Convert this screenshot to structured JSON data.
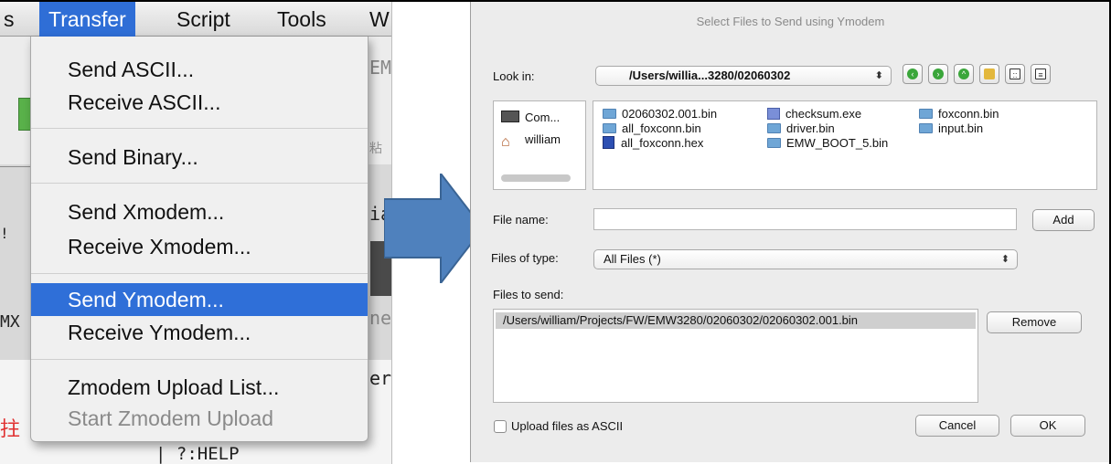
{
  "menubar": {
    "items": [
      {
        "label": "s"
      },
      {
        "label": "Transfer"
      },
      {
        "label": "Script"
      },
      {
        "label": "Tools"
      },
      {
        "label": "W"
      }
    ]
  },
  "transfer_menu": {
    "items": [
      {
        "label": "Send ASCII..."
      },
      {
        "label": "Receive ASCII..."
      },
      {
        "label": "Send Binary..."
      },
      {
        "label": "Send Xmodem..."
      },
      {
        "label": "Receive Xmodem..."
      },
      {
        "label": "Send Ymodem..."
      },
      {
        "label": "Receive Ymodem..."
      },
      {
        "label": "Zmodem Upload List..."
      },
      {
        "label": "Start Zmodem Upload"
      }
    ]
  },
  "background_app": {
    "text_em": "EM",
    "text_ia": "ia",
    "text_ne": "ne",
    "text_eri": "eri",
    "text_mx": "MX",
    "text_help": "| ?:HELP",
    "text_cjk": "粘"
  },
  "dialog": {
    "title": "Select Files to Send using Ymodem",
    "look_in_label": "Look in:",
    "look_in_value": "/Users/willia...3280/02060302",
    "places": [
      {
        "label": "Com...",
        "icon": "computer-icon"
      },
      {
        "label": "william",
        "icon": "home-icon"
      }
    ],
    "files": [
      {
        "name": "02060302.001.bin",
        "icon": "folder-icon"
      },
      {
        "name": "all_foxconn.bin",
        "icon": "folder-icon"
      },
      {
        "name": "all_foxconn.hex",
        "icon": "hex-file-icon"
      },
      {
        "name": "checksum.exe",
        "icon": "exe-file-icon"
      },
      {
        "name": "driver.bin",
        "icon": "folder-icon"
      },
      {
        "name": "EMW_BOOT_5.bin",
        "icon": "folder-icon"
      },
      {
        "name": "foxconn.bin",
        "icon": "folder-icon"
      },
      {
        "name": "input.bin",
        "icon": "folder-icon"
      }
    ],
    "file_name_label": "File name:",
    "file_name_value": "",
    "add_label": "Add",
    "files_of_type_label": "Files of type:",
    "files_of_type_value": "All Files (*)",
    "files_to_send_label": "Files to send:",
    "files_to_send": [
      "/Users/william/Projects/FW/EMW3280/02060302/02060302.001.bin"
    ],
    "remove_label": "Remove",
    "upload_ascii_label": "Upload files as ASCII",
    "cancel_label": "Cancel",
    "ok_label": "OK"
  }
}
